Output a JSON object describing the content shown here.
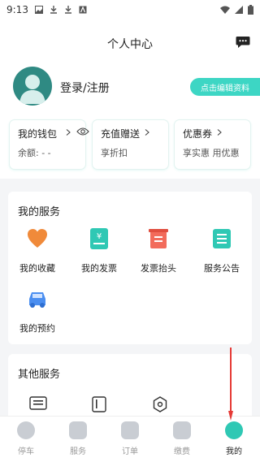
{
  "status_bar": {
    "time": "9:13"
  },
  "header": {
    "title": "个人中心"
  },
  "profile": {
    "login_text": "登录/注册",
    "edit_button": "点击编辑资料"
  },
  "wallet": {
    "cards": [
      {
        "title": "我的钱包",
        "subtitle": "余额: - -"
      },
      {
        "title": "充值赠送",
        "subtitle": "享折扣"
      },
      {
        "title": "优惠券",
        "subtitle": "享实惠 用优惠"
      }
    ]
  },
  "my_services": {
    "title": "我的服务",
    "items": [
      {
        "label": "我的收藏",
        "icon": "heart-icon"
      },
      {
        "label": "我的发票",
        "icon": "invoice-icon"
      },
      {
        "label": "发票抬头",
        "icon": "invoice-header-icon"
      },
      {
        "label": "服务公告",
        "icon": "announcement-icon"
      },
      {
        "label": "我的预约",
        "icon": "car-icon"
      }
    ]
  },
  "other_services": {
    "title": "其他服务"
  },
  "tabbar": {
    "tabs": [
      {
        "label": "停车",
        "icon": "parking-icon"
      },
      {
        "label": "服务",
        "icon": "service-icon"
      },
      {
        "label": "订单",
        "icon": "order-icon"
      },
      {
        "label": "缴费",
        "icon": "payment-icon"
      },
      {
        "label": "我的",
        "icon": "profile-icon",
        "active": true
      }
    ]
  },
  "colors": {
    "accent": "#3dd6c4",
    "annotation_arrow": "#e53935"
  }
}
